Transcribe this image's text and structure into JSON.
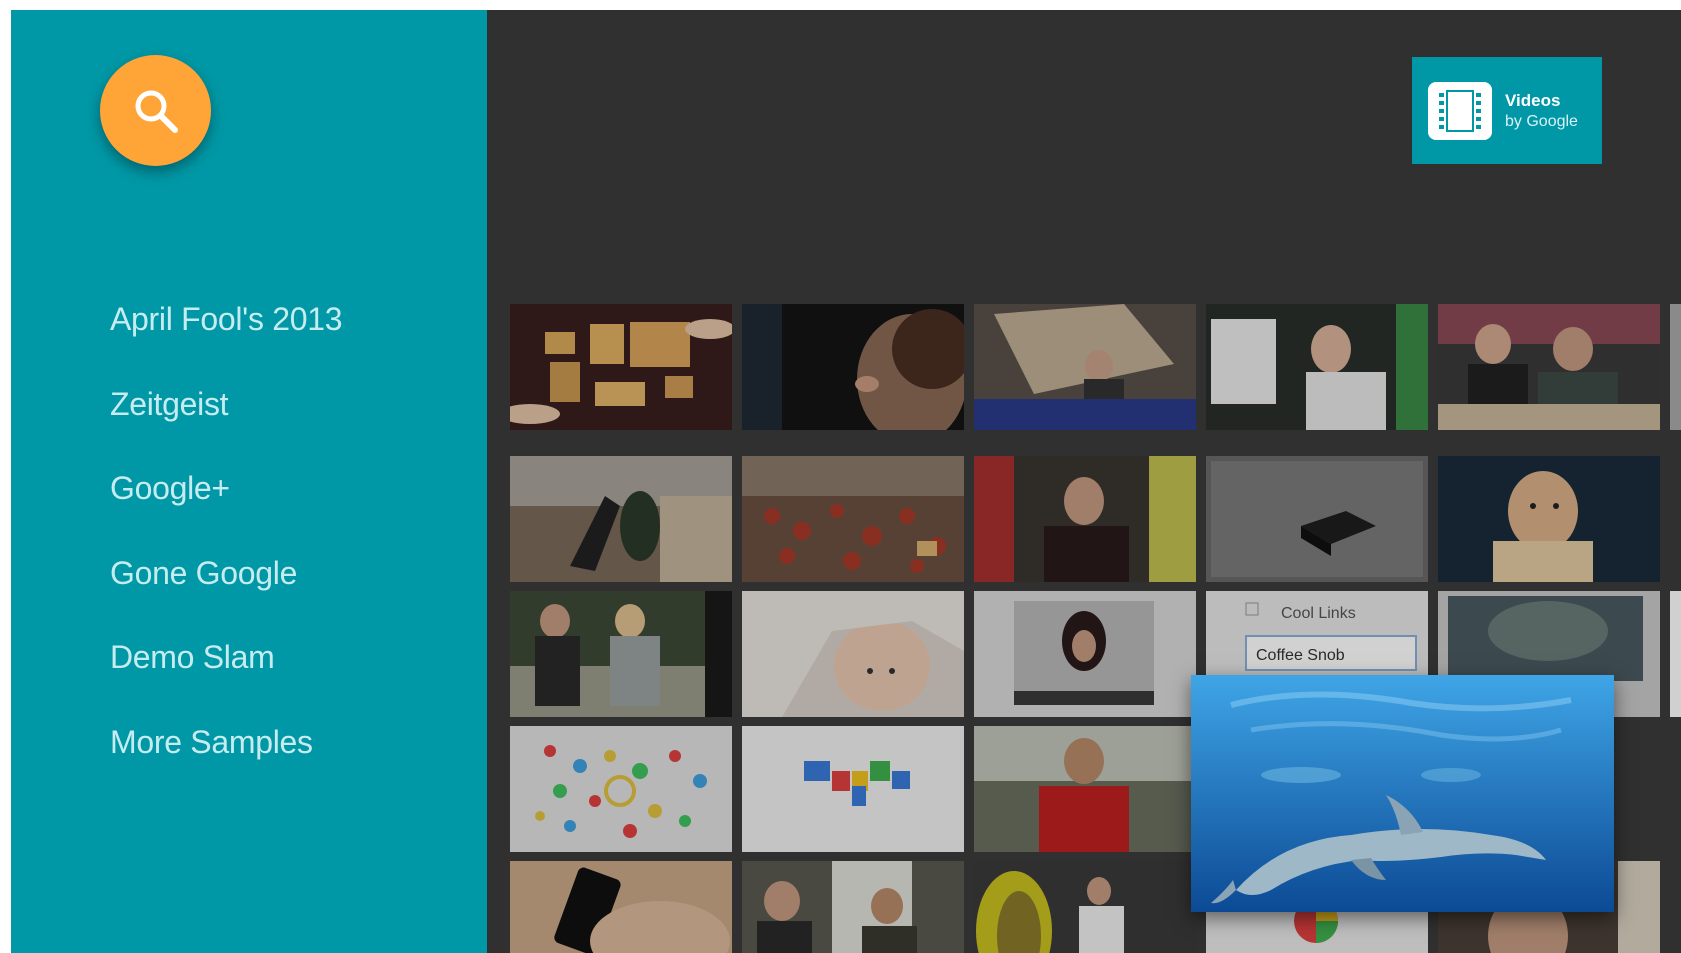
{
  "sidebar": {
    "background": "#0098a6",
    "search_icon": "search-icon",
    "search_orb_color": "#ffa436",
    "items": [
      {
        "label": "April Fool's 2013"
      },
      {
        "label": "Zeitgeist"
      },
      {
        "label": "Google+"
      },
      {
        "label": "Gone Google"
      },
      {
        "label": "Demo Slam"
      },
      {
        "label": "More Samples"
      }
    ]
  },
  "badge": {
    "icon": "film-strip-icon",
    "title": "Videos",
    "subtitle": "by Google"
  },
  "grid": {
    "tile_text": {
      "cool_links": "Cool Links",
      "coffee_snob": "Coffee Snob"
    }
  },
  "preview": {
    "subject": "dolphin-underwater"
  }
}
